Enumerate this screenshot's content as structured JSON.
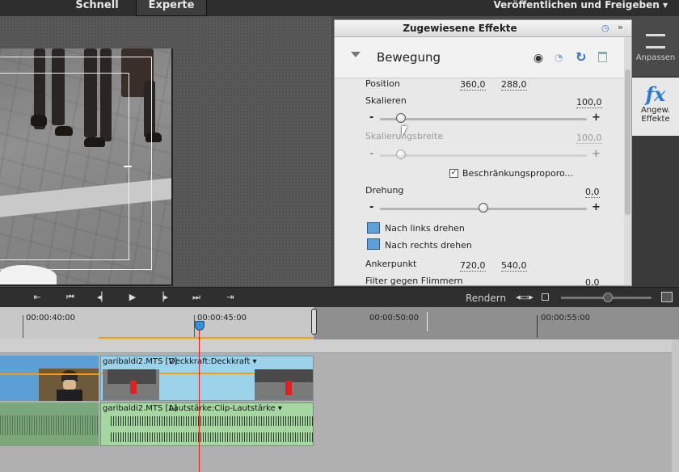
{
  "top_bar": {
    "tab_quick": "Schnell",
    "tab_expert": "Experte",
    "publish_menu": "Veröffentlichen und Freigeben"
  },
  "effects_panel": {
    "title": "Zugewiesene Effekte",
    "group_title": "Bewegung",
    "position": {
      "label": "Position",
      "x": "360,0",
      "y": "288,0"
    },
    "scale": {
      "label": "Skalieren",
      "value": "100,0",
      "level": 0.1
    },
    "scale_width": {
      "label": "Skalierungsbreite",
      "value": "100,0",
      "level": 0.1
    },
    "constrain_checkbox": {
      "label": "Beschränkungsproporo...",
      "checked": true
    },
    "rotation": {
      "label": "Drehung",
      "value": "0,0",
      "level": 0.5
    },
    "rotate_left": "Nach links drehen",
    "rotate_right": "Nach rechts drehen",
    "anchor": {
      "label": "Ankerpunkt",
      "x": "720,0",
      "y": "540,0"
    },
    "flicker": {
      "label": "Filter gegen Flimmern",
      "value": "0,0"
    },
    "minus": "-",
    "plus": "+"
  },
  "sidebar": {
    "adjust": "Anpassen",
    "applied_effects": "Angew. Effekte"
  },
  "transport": {
    "render": "Rendern"
  },
  "ruler": {
    "timecodes": [
      "00:00:40:00",
      "00:00:45:00",
      "00:00:50:00",
      "00:00:55:00"
    ]
  },
  "tracks": {
    "video_clip_name": "garibaldi2.MTS [V]",
    "video_effect": "Deckkraft:Deckkraft",
    "audio_clip_name": "garibaldi2.MTS [A]",
    "audio_effect": "Lautstärke:Clip-Lautstärke"
  }
}
